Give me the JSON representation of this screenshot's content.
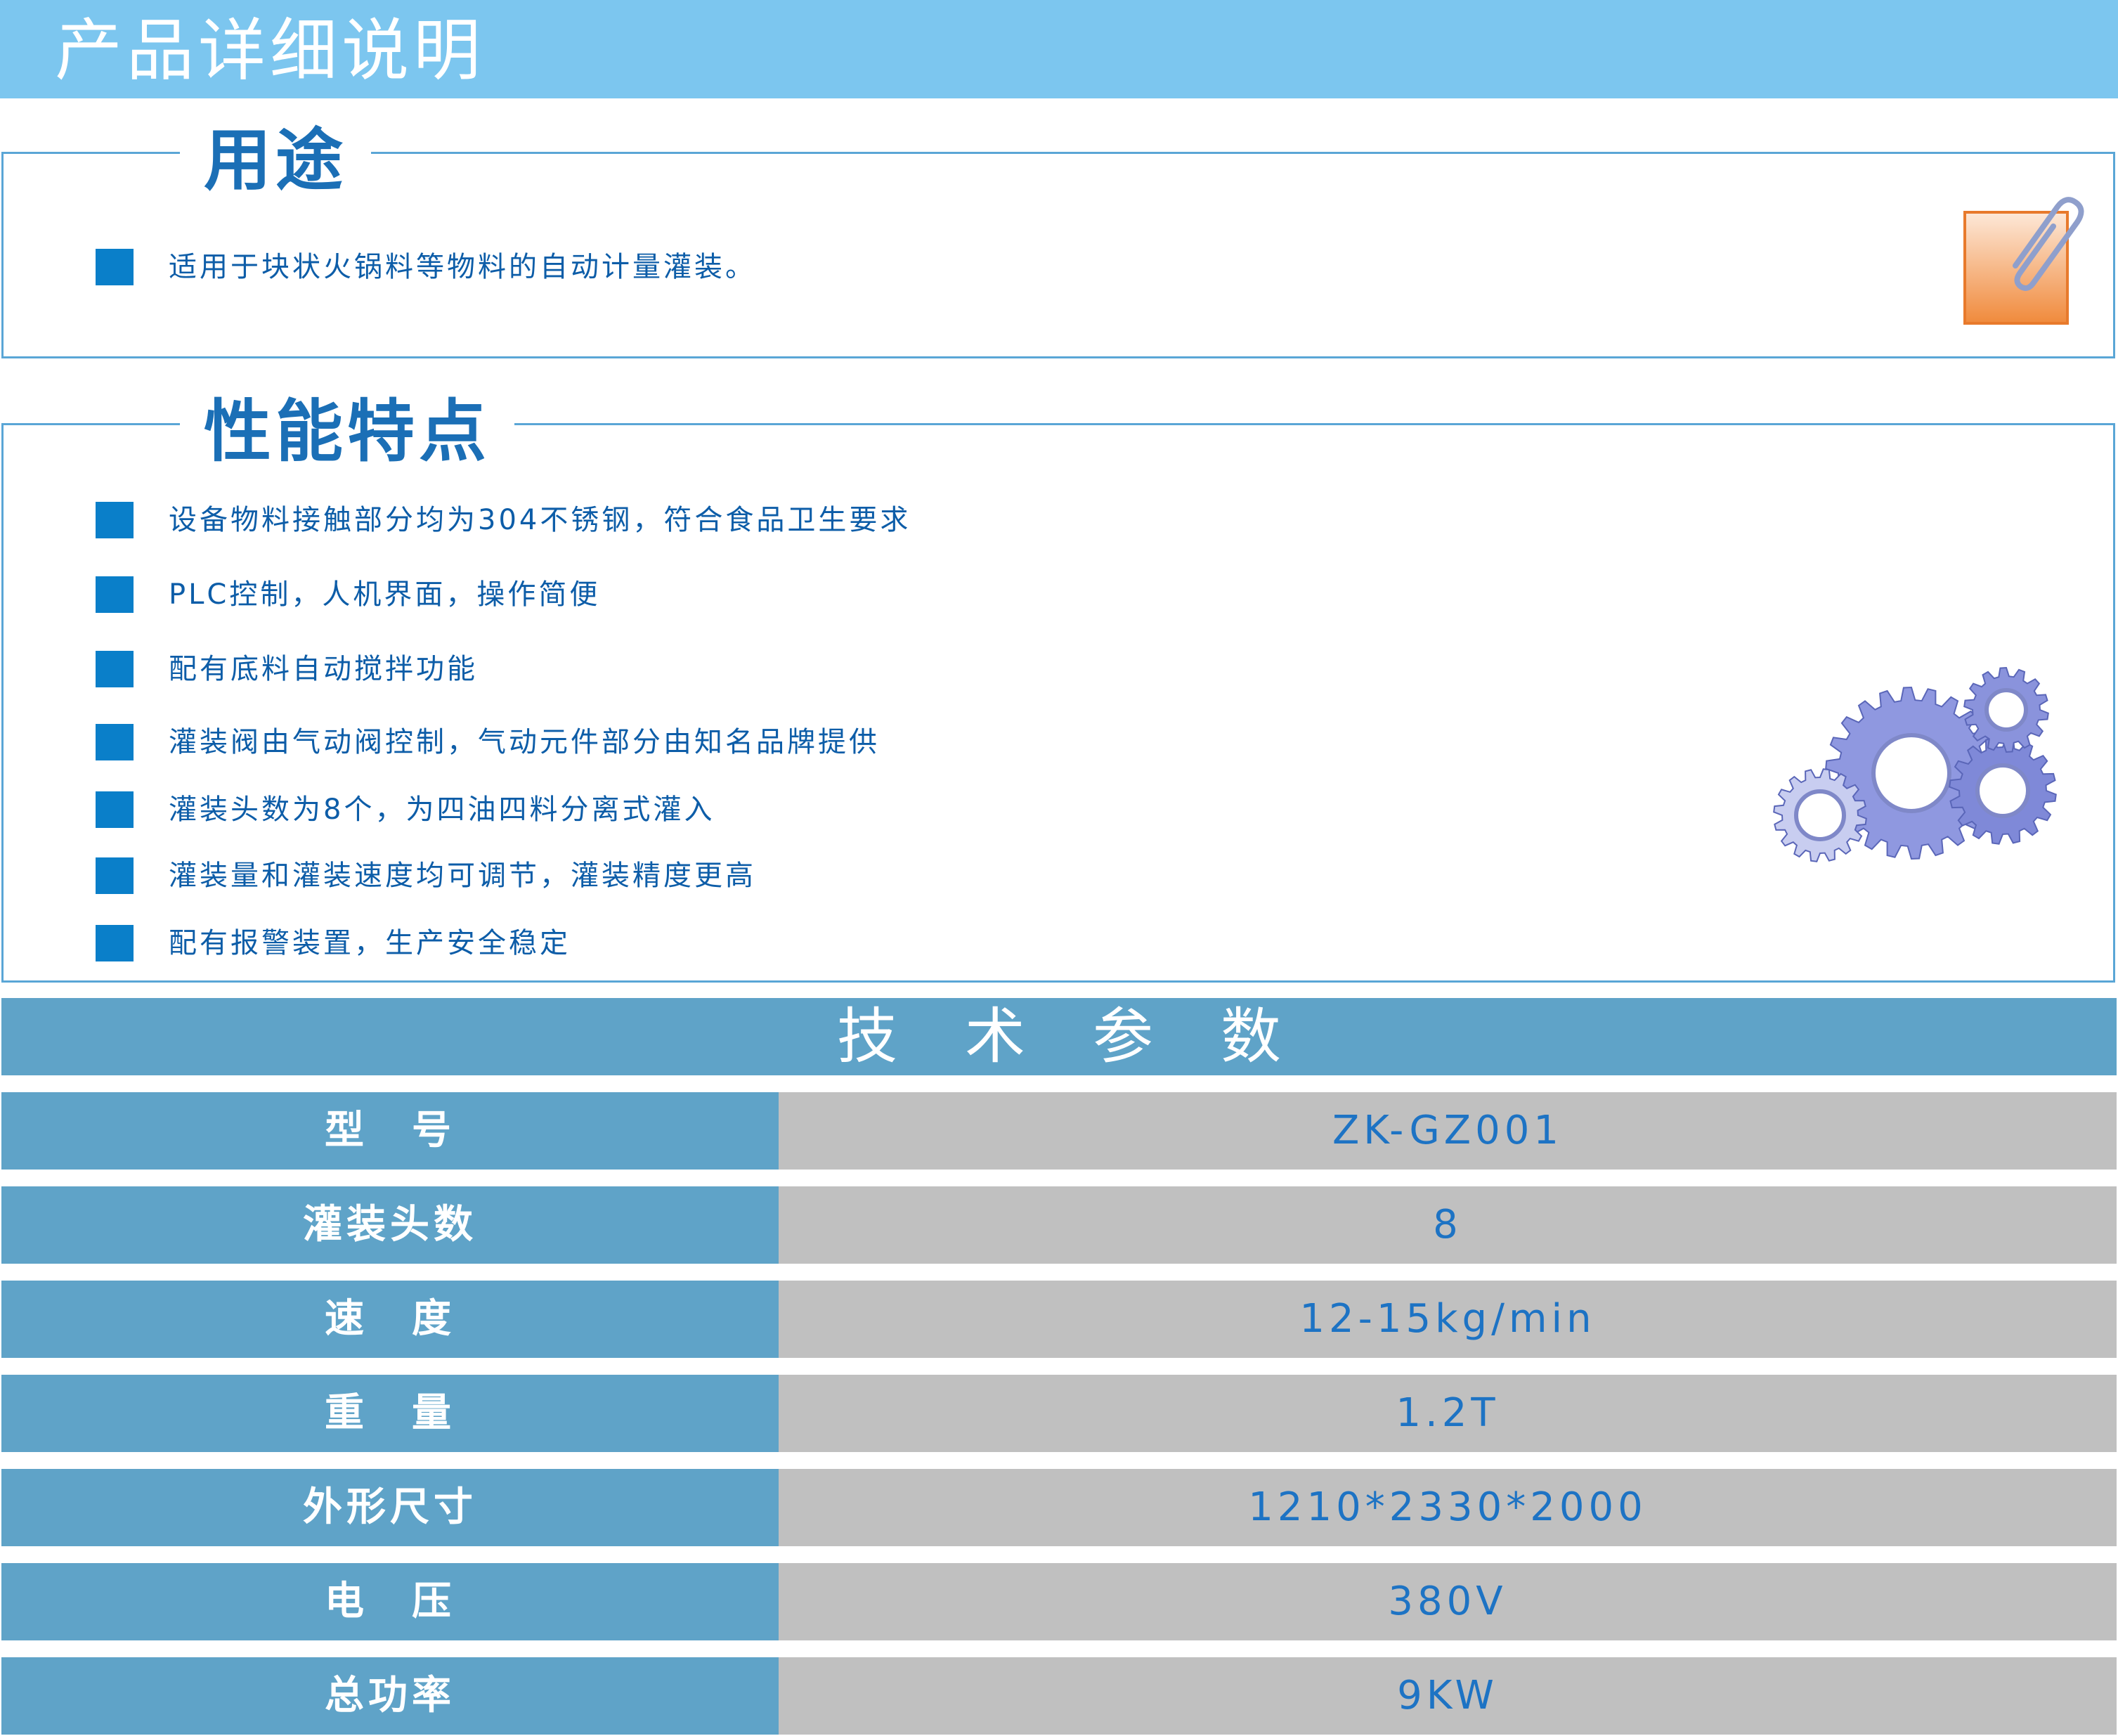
{
  "header": {
    "title": "产品详细说明"
  },
  "usage": {
    "title": "用途",
    "items": [
      "适用于块状火锅料等物料的自动计量灌装。"
    ],
    "icon": "paperclip-note-icon"
  },
  "features": {
    "title": "性能特点",
    "items": [
      "设备物料接触部分均为304不锈钢，符合食品卫生要求",
      "PLC控制，人机界面，操作简便",
      "配有底料自动搅拌功能",
      "灌装阀由气动阀控制，气动元件部分由知名品牌提供",
      "灌装头数为8个，为四油四料分离式灌入",
      "灌装量和灌装速度均可调节，灌装精度更高",
      "配有报警装置，生产安全稳定"
    ],
    "icon": "gears-icon"
  },
  "specs": {
    "title": "技术参数",
    "rows": [
      {
        "label": "型　号",
        "value": "ZK-GZ001"
      },
      {
        "label": "灌装头数",
        "value": "8"
      },
      {
        "label": "速　度",
        "value": "12-15kg/min"
      },
      {
        "label": "重　量",
        "value": "1.2T"
      },
      {
        "label": "外形尺寸",
        "value": "1210*2330*2000"
      },
      {
        "label": "电　压",
        "value": "380V"
      },
      {
        "label": "总功率",
        "value": "9KW"
      }
    ]
  },
  "colors": {
    "header_bar": "#7cc6ef",
    "accent_blue": "#0a7fc9",
    "section_title": "#1b6fb6",
    "spec_label_bg": "#5fa3c8",
    "spec_value_bg": "#c0c0c0",
    "spec_value_text": "#1d73c4",
    "note_orange": "#f08a3c"
  }
}
